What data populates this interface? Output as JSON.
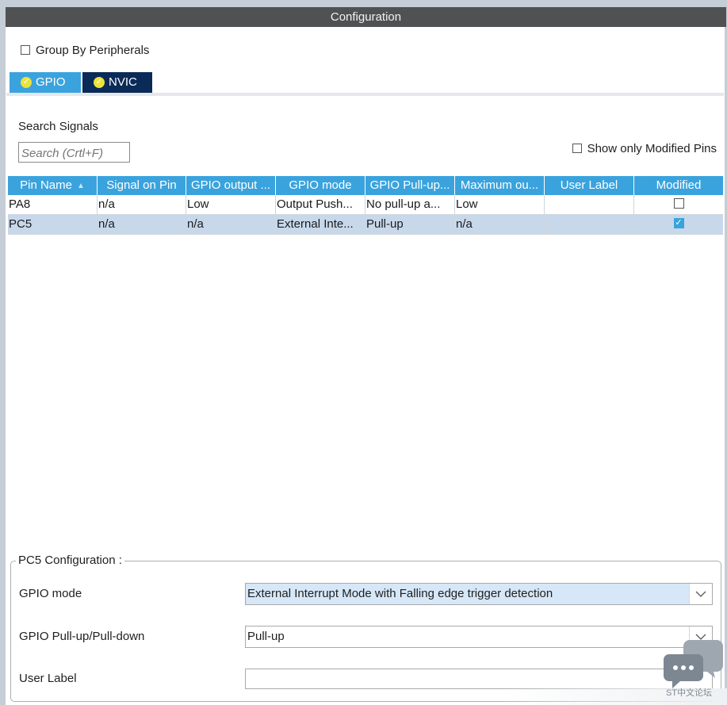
{
  "window": {
    "title": "Configuration"
  },
  "group_by": {
    "label": "Group By Peripherals",
    "checked": false
  },
  "tabs": [
    {
      "label": "GPIO",
      "icon": "check-circle-icon",
      "active": true
    },
    {
      "label": "NVIC",
      "icon": "check-circle-icon",
      "active": false
    }
  ],
  "search": {
    "label": "Search Signals",
    "placeholder": "Search (Crtl+F)"
  },
  "show_modified": {
    "label": "Show only Modified Pins",
    "checked": false
  },
  "table": {
    "columns": [
      "Pin Name",
      "Signal on Pin",
      "GPIO output ...",
      "GPIO mode",
      "GPIO Pull-up...",
      "Maximum ou...",
      "User Label",
      "Modified"
    ],
    "sort_icon": "sort-ascending-icon",
    "rows": [
      {
        "cells": [
          "PA8",
          "n/a",
          "Low",
          "Output Push...",
          "No pull-up a...",
          "Low",
          ""
        ],
        "modified": false,
        "selected": false
      },
      {
        "cells": [
          "PC5",
          "n/a",
          "n/a",
          "External Inte...",
          "Pull-up",
          "n/a",
          ""
        ],
        "modified": true,
        "selected": true
      }
    ]
  },
  "pin_config": {
    "title": "PC5 Configuration :",
    "gpio_mode": {
      "label": "GPIO mode",
      "value": "External Interrupt Mode with Falling edge trigger detection"
    },
    "pull": {
      "label": "GPIO Pull-up/Pull-down",
      "value": "Pull-up"
    },
    "user_label": {
      "label": "User Label",
      "value": ""
    }
  },
  "watermark": {
    "text": "ST中文论坛",
    "icon": "chat-bubbles-icon"
  },
  "colors": {
    "tab_active": "#3aa3dd",
    "tab_inactive": "#0a2a57",
    "header": "#3aa3dd",
    "titlebar": "#505153",
    "selected_row": "#c8d8eb"
  }
}
